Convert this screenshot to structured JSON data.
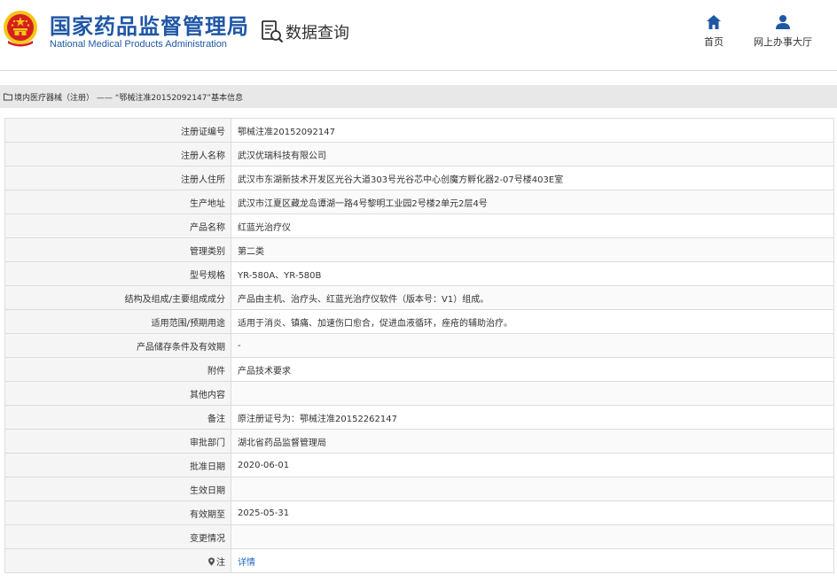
{
  "header": {
    "brand_cn": "国家药品监督管理局",
    "brand_en": "National Medical Products Administration",
    "query_label": "数据查询",
    "nav": [
      {
        "label": "首页",
        "icon": "home-icon"
      },
      {
        "label": "网上办事大厅",
        "icon": "user-icon"
      }
    ]
  },
  "breadcrumb": {
    "section": "境内医疗器械（注册）",
    "separator": "——",
    "current": "“鄂械注准20152092147”基本信息"
  },
  "fields": [
    {
      "label": "注册证编号",
      "value": "鄂械注准20152092147"
    },
    {
      "label": "注册人名称",
      "value": "武汉优瑞科技有限公司"
    },
    {
      "label": "注册人住所",
      "value": "武汉市东湖新技术开发区光谷大道303号光谷芯中心创魔方孵化器2-07号楼403E室"
    },
    {
      "label": "生产地址",
      "value": "武汉市江夏区藏龙岛谭湖一路4号黎明工业园2号楼2单元2层4号"
    },
    {
      "label": "产品名称",
      "value": "红蓝光治疗仪"
    },
    {
      "label": "管理类别",
      "value": "第二类"
    },
    {
      "label": "型号规格",
      "value": "YR-580A、YR-580B"
    },
    {
      "label": "结构及组成/主要组成成分",
      "value": "产品由主机、治疗头、红蓝光治疗仪软件（版本号：V1）组成。"
    },
    {
      "label": "适用范围/预期用途",
      "value": "适用于消炎、镇痛、加速伤口愈合，促进血液循环，痤疮的辅助治疗。"
    },
    {
      "label": "产品储存条件及有效期",
      "value": "-"
    },
    {
      "label": "附件",
      "value": "产品技术要求"
    },
    {
      "label": "其他内容",
      "value": ""
    },
    {
      "label": "备注",
      "value": "原注册证号为：鄂械注准20152262147"
    },
    {
      "label": "审批部门",
      "value": "湖北省药品监督管理局"
    },
    {
      "label": "批准日期",
      "value": "2020-06-01"
    },
    {
      "label": "生效日期",
      "value": ""
    },
    {
      "label": "有效期至",
      "value": "2025-05-31"
    },
    {
      "label": "变更情况",
      "value": ""
    }
  ],
  "note_row": {
    "label": "注",
    "value": "详情"
  },
  "colors": {
    "brand_blue": "#1f57a6",
    "link_blue": "#1f67c8",
    "emblem_red": "#d71f1f",
    "emblem_gold": "#f5c518"
  }
}
